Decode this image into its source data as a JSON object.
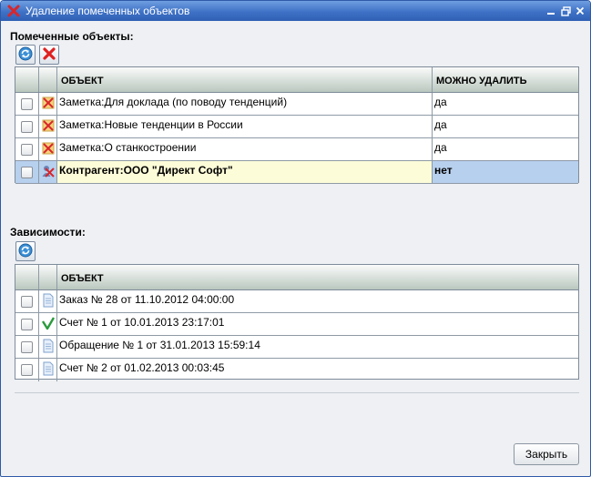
{
  "window": {
    "title": "Удаление помеченных объектов",
    "title_icon": "delete-cross-icon"
  },
  "marked": {
    "label": "Помеченные объекты:",
    "columns": [
      "ОБЪЕКТ",
      "МОЖНО УДАЛИТЬ"
    ],
    "rows": [
      {
        "icon": "note-deleted-icon",
        "object": "Заметка:Для доклада (по поводу тенденций)",
        "can_delete": "да",
        "selected": false
      },
      {
        "icon": "note-deleted-icon",
        "object": "Заметка:Новые тенденции в России",
        "can_delete": "да",
        "selected": false
      },
      {
        "icon": "note-deleted-icon",
        "object": "Заметка:О станкостроении",
        "can_delete": "да",
        "selected": false
      },
      {
        "icon": "contractor-deleted-icon",
        "object": "Контрагент:ООО \"Директ Софт\"",
        "can_delete": "нет",
        "selected": true
      }
    ]
  },
  "dependencies": {
    "label": "Зависимости:",
    "columns": [
      "ОБЪЕКТ"
    ],
    "rows": [
      {
        "icon": "document-icon",
        "object": "Заказ № 28 от 11.10.2012 04:00:00"
      },
      {
        "icon": "checkmark-icon",
        "object": "Счет № 1 от 10.01.2013 23:17:01"
      },
      {
        "icon": "document-icon",
        "object": "Обращение № 1 от 31.01.2013 15:59:14"
      },
      {
        "icon": "document-icon",
        "object": "Счет № 2 от 01.02.2013 00:03:45"
      }
    ]
  },
  "footer": {
    "close_label": "Закрыть"
  },
  "colors": {
    "titlebar": "#3f72c6",
    "selected_row": "#fdfcd8",
    "selected_cell": "#b7d0ee"
  }
}
